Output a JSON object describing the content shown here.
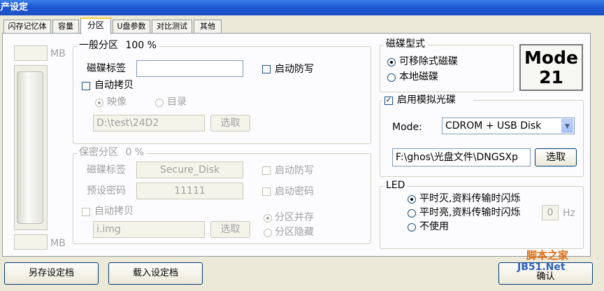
{
  "window": {
    "title": "生产设定"
  },
  "tabs": [
    "闪存记忆体",
    "容量",
    "分区",
    "U盘参数",
    "对比测试",
    "其他"
  ],
  "capacity_bar": {
    "top_unit": "MB",
    "bottom_unit": "MB"
  },
  "general_partition": {
    "title": "一般分区",
    "percent": "100 %",
    "disk_label_caption": "磁碟标签",
    "disk_label_value": "",
    "write_protect": "启动防写",
    "auto_copy": "自动拷贝",
    "radio_image": "映像",
    "radio_dir": "目录",
    "path": "D:\\test\\24D2",
    "browse": "选取"
  },
  "secure_partition": {
    "title": "保密分区",
    "percent": "0 %",
    "disk_label_caption": "磁碟标签",
    "disk_label_value": "Secure_Disk",
    "write_protect": "启动防写",
    "password_caption": "预设密码",
    "password_value": "11111",
    "enable_password": "启动密码",
    "auto_copy": "自动拷贝",
    "path": "i.img",
    "browse": "选取",
    "coexist": "分区并存",
    "hide": "分区隐藏"
  },
  "disk_type": {
    "title": "磁碟型式",
    "removable": "可移除式磁碟",
    "local": "本地磁碟"
  },
  "mode_badge": {
    "line1": "Mode",
    "line2": "21"
  },
  "cdrom": {
    "title": "启用模拟光碟",
    "mode_caption": "Mode:",
    "mode_value": "CDROM + USB Disk",
    "path": "F:\\ghos\\光盘文件\\DNGSXp",
    "browse": "选取"
  },
  "led": {
    "title": "LED",
    "opt1": "平时灭,资料传输时闪烁",
    "opt2": "平时亮,资料传输时闪烁",
    "hz_value": "0",
    "hz_unit": "Hz",
    "opt3": "不使用"
  },
  "bottom": {
    "save": "另存设定档",
    "load": "载入设定档",
    "ok": "确认"
  },
  "watermark": {
    "line1": "脚本之家",
    "line2": "JB51.Net"
  }
}
